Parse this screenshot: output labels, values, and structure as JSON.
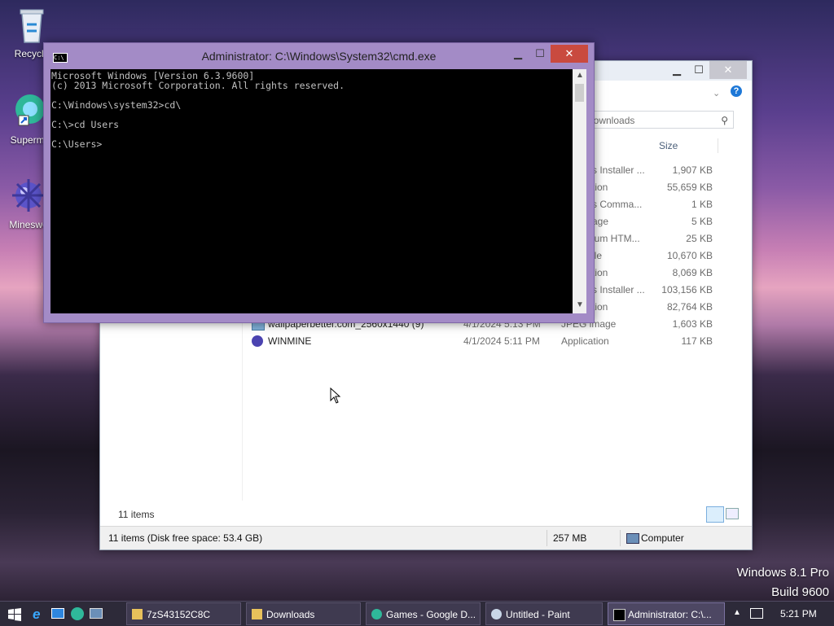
{
  "desktop": {
    "icons": [
      {
        "label": "Recycle"
      },
      {
        "label": "Supermi"
      },
      {
        "label": "Mineswe"
      }
    ],
    "watermark": {
      "line1": "Windows 8.1 Pro",
      "line2": "Build 9600"
    }
  },
  "explorer": {
    "search_placeholder": "rch Downloads",
    "columns": {
      "size": "Size"
    },
    "partial_rows": [
      {
        "type": "s Installer ...",
        "size": "1,907 KB"
      },
      {
        "type": "tion",
        "size": "55,659 KB"
      },
      {
        "type": "s Comma...",
        "size": "1 KB"
      },
      {
        "type": "age",
        "size": "5 KB"
      },
      {
        "type": "ium HTM...",
        "size": "25 KB"
      },
      {
        "type": "ile",
        "size": "10,670 KB"
      },
      {
        "type": "tion",
        "size": "8,069 KB"
      },
      {
        "type": "s Installer ...",
        "size": "103,156 KB"
      },
      {
        "type": "tion",
        "size": "82,764 KB"
      }
    ],
    "rows": [
      {
        "name": "wallpaperbetter.com_2560x1440 (9)",
        "date": "4/1/2024 5:13 PM",
        "type": "JPEG image",
        "size": "1,603 KB"
      },
      {
        "name": "WINMINE",
        "date": "4/1/2024 5:11 PM",
        "type": "Application",
        "size": "117 KB"
      }
    ],
    "item_count": "11 items",
    "status": {
      "left": "11 items (Disk free space: 53.4 GB)",
      "middle": "257 MB",
      "right": "Computer"
    }
  },
  "cmd": {
    "title": "Administrator: C:\\Windows\\System32\\cmd.exe",
    "lines": [
      "Microsoft Windows [Version 6.3.9600]",
      "(c) 2013 Microsoft Corporation. All rights reserved.",
      "",
      "C:\\Windows\\system32>cd\\",
      "",
      "C:\\>cd Users",
      "",
      "C:\\Users>"
    ]
  },
  "taskbar": {
    "items": [
      {
        "label": "7zS43152C8C"
      },
      {
        "label": "Downloads"
      },
      {
        "label": "Games - Google D..."
      },
      {
        "label": "Untitled - Paint"
      },
      {
        "label": "Administrator: C:\\..."
      }
    ],
    "clock": "5:21 PM"
  }
}
